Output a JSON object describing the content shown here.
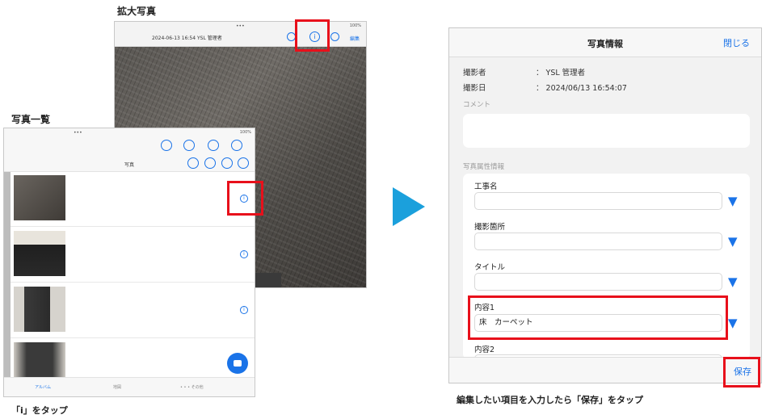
{
  "captions": {
    "zoom": "拡大写真",
    "list": "写真一覧",
    "tap_i": "「i」をタップ",
    "instruction": "編集したい項目を入力したら「保存」をタップ"
  },
  "zoom_screen": {
    "title": "2024-06-13 16:54 YSL 管理者",
    "edit_label": "編集",
    "status": "100%"
  },
  "list_screen": {
    "title": "写真",
    "status": "100%",
    "info_symbol": "i",
    "tabs": [
      "アルバム",
      "地図",
      "• • •  その他"
    ]
  },
  "info_panel": {
    "title": "写真情報",
    "close_label": "閉じる",
    "photographer_label": "撮影者",
    "photographer_value": "：  YSL 管理者",
    "date_label": "撮影日",
    "date_value": "：  2024/06/13 16:54:07",
    "comment_label": "コメント",
    "attributes_label": "写真属性情報",
    "fields": [
      {
        "label": "工事名",
        "value": ""
      },
      {
        "label": "撮影箇所",
        "value": ""
      },
      {
        "label": "タイトル",
        "value": ""
      },
      {
        "label": "内容1",
        "value": "床　カーペット"
      },
      {
        "label": "内容2",
        "value": ""
      }
    ],
    "dropdown_symbol": "▼",
    "save_label": "保存"
  },
  "colors": {
    "accent": "#1a73e8",
    "highlight": "#e8101b",
    "arrow": "#1ba0dc"
  }
}
